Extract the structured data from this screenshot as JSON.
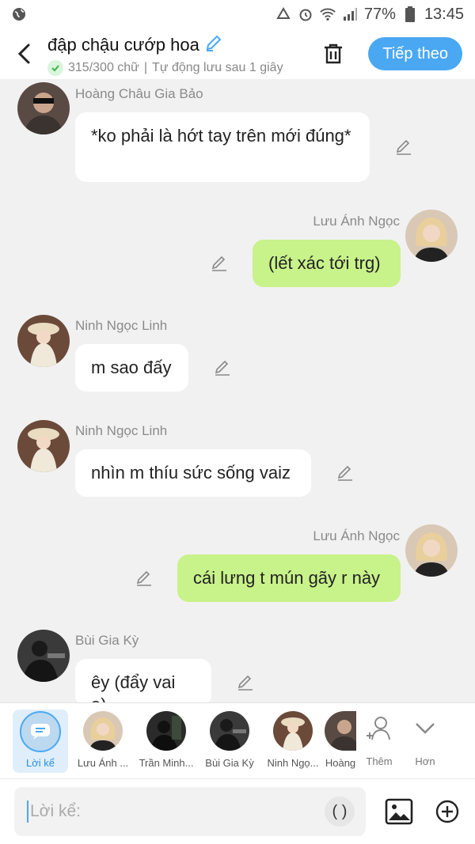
{
  "status_bar": {
    "battery_percent": "77%",
    "time": "13:45"
  },
  "header": {
    "title": "đập chậu cướp hoa",
    "char_count": "315/300 chữ",
    "autosave": "Tự động lưu sau 1 giây",
    "next_label": "Tiếp theo"
  },
  "messages": [
    {
      "side": "left",
      "name": "Hoàng Châu Gia Bảo",
      "text": "*ko phải là hớt tay trên mới đúng*"
    },
    {
      "side": "right",
      "name": "Lưu Ánh Ngọc",
      "text": "(lết xác tới trg)"
    },
    {
      "side": "left",
      "name": "Ninh Ngọc Linh",
      "text": "m sao đấy"
    },
    {
      "side": "left",
      "name": "Ninh Ngọc Linh",
      "text": "nhìn m thíu sức sống vaiz"
    },
    {
      "side": "right",
      "name": "Lưu Ánh Ngọc",
      "text": "cái lưng t mún gãy r này"
    },
    {
      "side": "left",
      "name": "Bùi Gia Kỳ",
      "text": "êy (đẩy vai a)"
    }
  ],
  "selector": {
    "narration_label": "Lời kể",
    "characters": [
      "Lưu Ánh ...",
      "Trần Minh...",
      "Bùi Gia Kỳ",
      "Ninh Ngọ...",
      "Hoàng"
    ],
    "add_label": "Thêm",
    "more_label": "Hơn"
  },
  "input": {
    "placeholder": "Lời kể:",
    "paren_label": "( )"
  },
  "colors": {
    "accent": "#4aa8f3",
    "right_bubble": "#c8f28a",
    "left_bubble": "#ffffff",
    "background": "#f1f1f1"
  }
}
